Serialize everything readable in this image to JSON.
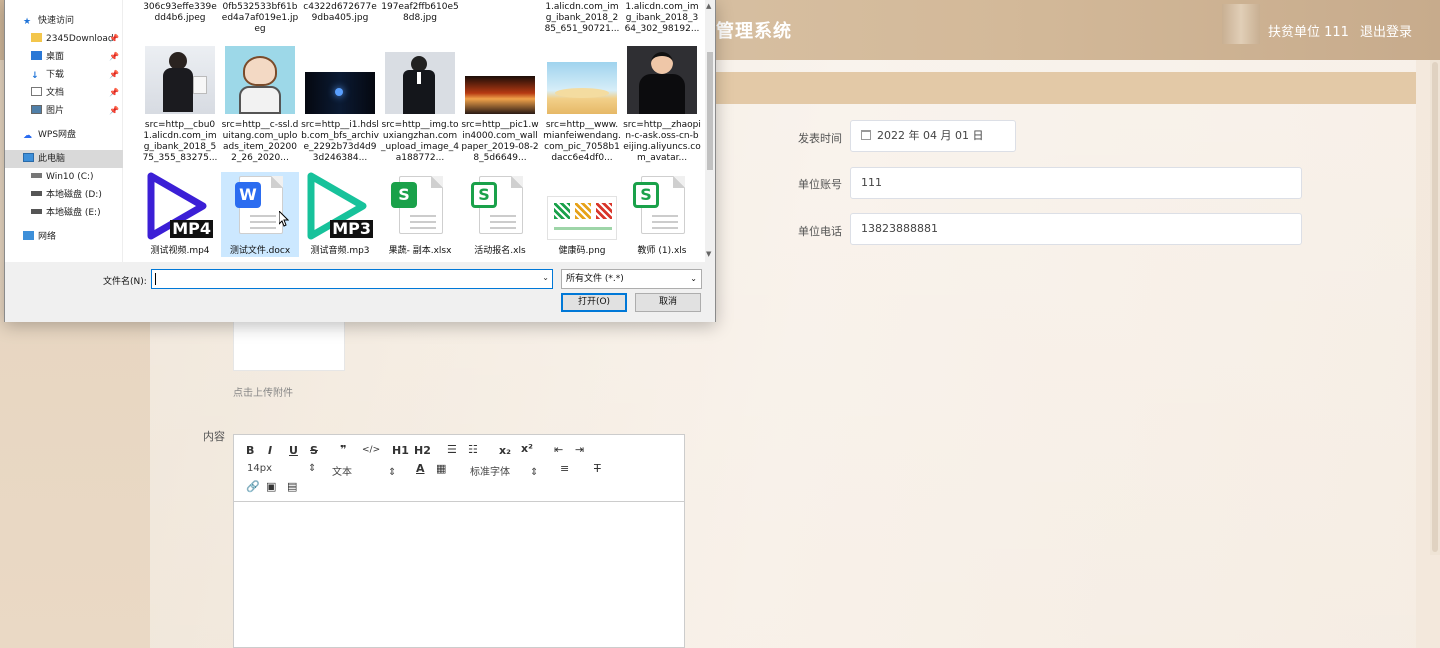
{
  "app": {
    "brand_partial": "管理系统",
    "user_unit": "扶贫单位 111",
    "logout": "退出登录"
  },
  "form": {
    "publish_time_label": "发表时间",
    "publish_time_value": "2022 年 04 月 01 日",
    "unit_account_label": "单位账号",
    "unit_account_value": "111",
    "unit_phone_label": "单位电话",
    "unit_phone_value": "13823888881",
    "upload_hint": "点击上传附件",
    "content_label": "内容"
  },
  "editor": {
    "font_size": "14px",
    "text_style": "文本",
    "font_family": "标准字体",
    "toolbar_row1": [
      "B",
      "I",
      "U",
      "S",
      "❞",
      "</>",
      "H1",
      "H2",
      "ol",
      "ul",
      "x₂",
      "x²",
      "outdent",
      "indent"
    ]
  },
  "dialog": {
    "nav": [
      {
        "label": "快速访问",
        "icon": "star-icon",
        "pinned": false
      },
      {
        "label": "2345Download",
        "icon": "folder-icon",
        "pinned": true
      },
      {
        "label": "桌面",
        "icon": "desktop-icon",
        "pinned": true
      },
      {
        "label": "下载",
        "icon": "download-icon",
        "pinned": true
      },
      {
        "label": "文档",
        "icon": "document-icon",
        "pinned": true
      },
      {
        "label": "图片",
        "icon": "picture-icon",
        "pinned": true
      },
      {
        "label": "WPS网盘",
        "icon": "cloud-icon",
        "pinned": false
      },
      {
        "label": "此电脑",
        "icon": "computer-icon",
        "pinned": false
      },
      {
        "label": "Win10 (C:)",
        "icon": "drive-icon",
        "pinned": false
      },
      {
        "label": "本地磁盘 (D:)",
        "icon": "drive-icon",
        "pinned": false
      },
      {
        "label": "本地磁盘 (E:)",
        "icon": "drive-icon",
        "pinned": false
      },
      {
        "label": "网络",
        "icon": "network-icon",
        "pinned": false
      }
    ],
    "row0": [
      "306c93effe339edd4b6.jpeg",
      "0fb532533bf61bed4a7af019e1.jpeg",
      "c4322d672677e9dba405.jpg",
      "197eaf2ffb610e58d8.jpg",
      "",
      "1.alicdn.com_img_ibank_2018_285_651_90721...",
      "1.alicdn.com_img_ibank_2018_364_302_98192..."
    ],
    "row1": [
      "src=http__cbu01.alicdn.com_img_ibank_2018_575_355_83275...",
      "src=http__c-ssl.duitang.com_uploads_item_202002_26_2020...",
      "src=http__i1.hdslb.com_bfs_archive_2292b73d4d93d246384...",
      "src=http__img.touxiangzhan.com_upload_image_4a188772...",
      "src=http__pic1.win4000.com_wallpaper_2019-08-28_5d6649...",
      "src=http__www.mianfeiwendang.com_pic_7058b1dacc6e4df0...",
      "src=http__zhaopin-c-ask.oss-cn-beijing.aliyuncs.com_avatar..."
    ],
    "row2": [
      "测试视频.mp4",
      "测试文件.docx",
      "测试音频.mp3",
      "果蔬- 副本.xlsx",
      "活动报名.xls",
      "健康码.png",
      "教师 (1).xls"
    ],
    "media_labels": {
      "mp4": "MP4",
      "mp3": "MP3",
      "w": "W",
      "s": "S"
    },
    "filename_label": "文件名(N):",
    "filename_value": "",
    "filetype": "所有文件 (*.*)",
    "open": "打开(O)",
    "cancel": "取消"
  },
  "colors": {
    "accent_blue": "#0078d7",
    "wps_green": "#1aa14a",
    "mp4_purple": "#3b1fd6",
    "mp3_teal": "#17c29b",
    "wps_blue": "#2b6cf0"
  }
}
